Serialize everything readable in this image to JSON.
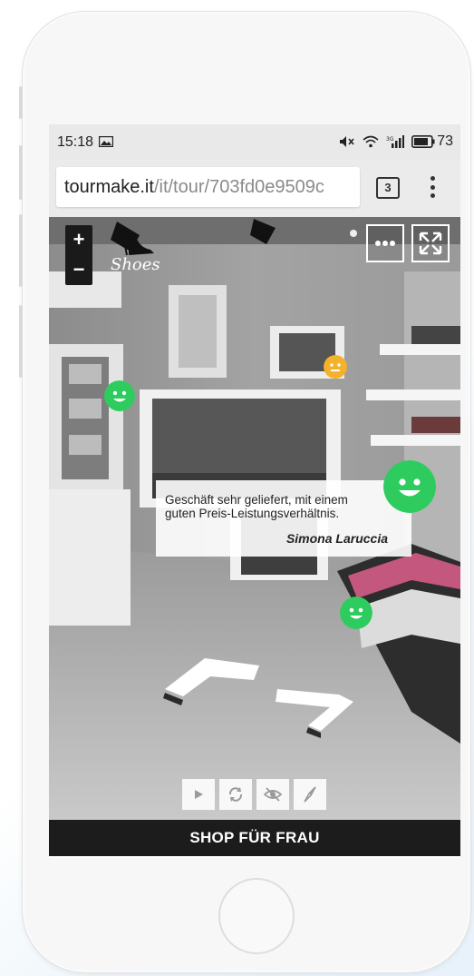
{
  "status_bar": {
    "time": "15:18",
    "battery": "73"
  },
  "browser": {
    "url_host": "tourmake.it",
    "url_path": "/it/tour/703fd0e9509c",
    "tab_count": "3"
  },
  "tour": {
    "zoom_in_label": "+",
    "zoom_out_label": "−",
    "logo_text": "Shoes",
    "review": {
      "text": "Geschäft sehr geliefert, mit einem guten Preis-Leistungsverhältnis.",
      "author": "Simona Laruccia"
    },
    "controls": [
      "play-icon",
      "rotate-icon",
      "hide-icon",
      "compass-icon"
    ],
    "footer_title": "SHOP FÜR FRAU"
  },
  "colors": {
    "smiley_green": "#2ecc5e",
    "smiley_orange": "#f5b12a",
    "footer_bg": "#1c1c1c"
  }
}
